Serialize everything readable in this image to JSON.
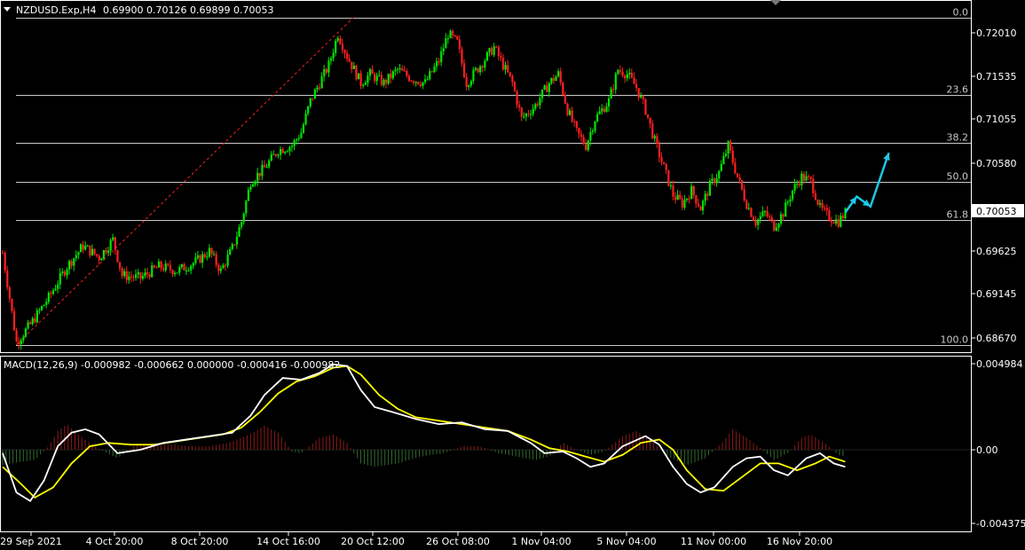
{
  "header": {
    "symbol_timeframe": "NZDUSD.Exp,H4",
    "ohlc": "0.69900 0.70126 0.69899 0.70053"
  },
  "macd": {
    "label": "MACD(12,26,9) -0.000982 -0.000662 0.000000 -0.000416 -0.000982"
  },
  "current_price": "0.70053",
  "colors": {
    "background": "#000000",
    "bull_candle": "#00e600",
    "bear_candle": "#ff2020",
    "fib_lines": "#c8c8c8",
    "fib_trend": "#ff2020",
    "macd_line": "#ffffff",
    "signal_line": "#ffff00",
    "hist_pos": "#8b1a1a",
    "hist_neg": "#2f6b2f",
    "arrows": "#1ec8e6",
    "axis": "#ffffff"
  },
  "chart_data": [
    {
      "type": "candlestick",
      "ylim": [
        0.6845,
        0.724
      ],
      "y_ticks": [
        "0.72010",
        "0.71535",
        "0.71055",
        "0.70580",
        "0.70100",
        "0.69625",
        "0.69145",
        "0.68670"
      ],
      "x_ticks": [
        "29 Sep 2021",
        "4 Oct 20:00",
        "8 Oct 20:00",
        "14 Oct 16:00",
        "20 Oct 12:00",
        "26 Oct 08:00",
        "1 Nov 04:00",
        "5 Nov 04:00",
        "11 Nov 00:00",
        "16 Nov 20:00"
      ],
      "fibonacci": [
        {
          "label": "0.0",
          "price": 0.7223
        },
        {
          "label": "23.6",
          "price": 0.7137
        },
        {
          "label": "38.2",
          "price": 0.7083
        },
        {
          "label": "50.0",
          "price": 0.704
        },
        {
          "label": "61.8",
          "price": 0.6997
        },
        {
          "label": "100.0",
          "price": 0.6857
        }
      ],
      "close_path": [
        [
          0,
          0.696
        ],
        [
          6,
          0.686
        ],
        [
          12,
          0.688
        ],
        [
          20,
          0.691
        ],
        [
          28,
          0.6945
        ],
        [
          35,
          0.6968
        ],
        [
          42,
          0.6955
        ],
        [
          48,
          0.6975
        ],
        [
          52,
          0.6935
        ],
        [
          60,
          0.6932
        ],
        [
          68,
          0.6945
        ],
        [
          76,
          0.694
        ],
        [
          84,
          0.695
        ],
        [
          90,
          0.6962
        ],
        [
          95,
          0.694
        ],
        [
          100,
          0.6965
        ],
        [
          104,
          0.6995
        ],
        [
          108,
          0.704
        ],
        [
          114,
          0.7055
        ],
        [
          120,
          0.7075
        ],
        [
          126,
          0.708
        ],
        [
          130,
          0.7095
        ],
        [
          134,
          0.713
        ],
        [
          138,
          0.715
        ],
        [
          142,
          0.717
        ],
        [
          146,
          0.7205
        ],
        [
          150,
          0.718
        ],
        [
          156,
          0.715
        ],
        [
          160,
          0.716
        ],
        [
          166,
          0.715
        ],
        [
          172,
          0.7165
        ],
        [
          178,
          0.7155
        ],
        [
          184,
          0.715
        ],
        [
          190,
          0.7175
        ],
        [
          194,
          0.7205
        ],
        [
          198,
          0.7195
        ],
        [
          202,
          0.715
        ],
        [
          208,
          0.717
        ],
        [
          214,
          0.719
        ],
        [
          218,
          0.717
        ],
        [
          222,
          0.715
        ],
        [
          226,
          0.711
        ],
        [
          232,
          0.7125
        ],
        [
          238,
          0.715
        ],
        [
          242,
          0.716
        ],
        [
          246,
          0.712
        ],
        [
          250,
          0.7095
        ],
        [
          254,
          0.708
        ],
        [
          258,
          0.711
        ],
        [
          264,
          0.713
        ],
        [
          268,
          0.7165
        ],
        [
          272,
          0.716
        ],
        [
          276,
          0.7145
        ],
        [
          280,
          0.712
        ],
        [
          284,
          0.7085
        ],
        [
          288,
          0.7055
        ],
        [
          292,
          0.7025
        ],
        [
          296,
          0.7015
        ],
        [
          300,
          0.703
        ],
        [
          304,
          0.701
        ],
        [
          308,
          0.7035
        ],
        [
          312,
          0.705
        ],
        [
          316,
          0.708
        ],
        [
          320,
          0.7045
        ],
        [
          324,
          0.7015
        ],
        [
          328,
          0.6995
        ],
        [
          332,
          0.7005
        ],
        [
          336,
          0.699
        ],
        [
          340,
          0.7005
        ],
        [
          344,
          0.703
        ],
        [
          348,
          0.7045
        ],
        [
          352,
          0.704
        ],
        [
          356,
          0.701
        ],
        [
          360,
          0.7
        ],
        [
          364,
          0.6995
        ],
        [
          367,
          0.7005
        ]
      ],
      "annotation_path": [
        [
          367,
          0.70053
        ],
        [
          372,
          0.7023
        ],
        [
          378,
          0.7012
        ],
        [
          386,
          0.7072
        ]
      ]
    },
    {
      "type": "macd",
      "params": "12,26,9",
      "y_ticks": [
        "0.004984",
        "0.00",
        "-0.004375"
      ],
      "ylim": [
        -0.00492,
        0.00534
      ],
      "macd_line": [
        [
          0,
          -0.0002
        ],
        [
          6,
          -0.0025
        ],
        [
          12,
          -0.003
        ],
        [
          18,
          -0.0018
        ],
        [
          24,
          0.0002
        ],
        [
          30,
          0.001
        ],
        [
          36,
          0.0012
        ],
        [
          42,
          0.0009
        ],
        [
          50,
          -0.0002
        ],
        [
          60,
          0.0
        ],
        [
          70,
          0.0004
        ],
        [
          80,
          0.0006
        ],
        [
          90,
          0.0008
        ],
        [
          100,
          0.001
        ],
        [
          108,
          0.002
        ],
        [
          114,
          0.0032
        ],
        [
          122,
          0.0042
        ],
        [
          130,
          0.0041
        ],
        [
          138,
          0.0045
        ],
        [
          144,
          0.005
        ],
        [
          150,
          0.0049
        ],
        [
          156,
          0.0035
        ],
        [
          162,
          0.0025
        ],
        [
          170,
          0.0022
        ],
        [
          180,
          0.0018
        ],
        [
          190,
          0.0015
        ],
        [
          200,
          0.0016
        ],
        [
          210,
          0.0012
        ],
        [
          220,
          0.0011
        ],
        [
          230,
          0.0004
        ],
        [
          236,
          -0.0002
        ],
        [
          244,
          -0.0001
        ],
        [
          250,
          -0.0005
        ],
        [
          256,
          -0.001
        ],
        [
          262,
          -0.0008
        ],
        [
          270,
          0.0002
        ],
        [
          280,
          0.0008
        ],
        [
          286,
          0.0003
        ],
        [
          292,
          -0.001
        ],
        [
          298,
          -0.002
        ],
        [
          304,
          -0.0025
        ],
        [
          310,
          -0.0022
        ],
        [
          318,
          -0.001
        ],
        [
          324,
          -0.0005
        ],
        [
          330,
          -0.0004
        ],
        [
          336,
          -0.0012
        ],
        [
          342,
          -0.0015
        ],
        [
          350,
          -0.0005
        ],
        [
          356,
          -0.0002
        ],
        [
          362,
          -0.0008
        ],
        [
          367,
          -0.001
        ]
      ],
      "signal_line": [
        [
          0,
          -0.001
        ],
        [
          8,
          -0.002
        ],
        [
          14,
          -0.0028
        ],
        [
          22,
          -0.0022
        ],
        [
          30,
          -0.0008
        ],
        [
          38,
          0.0002
        ],
        [
          46,
          0.0004
        ],
        [
          56,
          0.0003
        ],
        [
          66,
          0.0003
        ],
        [
          76,
          0.0005
        ],
        [
          86,
          0.0007
        ],
        [
          96,
          0.0009
        ],
        [
          104,
          0.0013
        ],
        [
          112,
          0.0022
        ],
        [
          120,
          0.0033
        ],
        [
          128,
          0.004
        ],
        [
          136,
          0.0043
        ],
        [
          144,
          0.0048
        ],
        [
          150,
          0.0049
        ],
        [
          156,
          0.0044
        ],
        [
          164,
          0.0032
        ],
        [
          172,
          0.0024
        ],
        [
          180,
          0.0019
        ],
        [
          190,
          0.0017
        ],
        [
          200,
          0.0015
        ],
        [
          210,
          0.0013
        ],
        [
          220,
          0.0011
        ],
        [
          230,
          0.0006
        ],
        [
          238,
          0.0001
        ],
        [
          246,
          -0.0001
        ],
        [
          254,
          -0.0004
        ],
        [
          262,
          -0.0007
        ],
        [
          270,
          -0.0003
        ],
        [
          278,
          0.0004
        ],
        [
          286,
          0.0006
        ],
        [
          292,
          0.0
        ],
        [
          298,
          -0.0012
        ],
        [
          306,
          -0.0023
        ],
        [
          314,
          -0.0024
        ],
        [
          322,
          -0.0016
        ],
        [
          330,
          -0.0008
        ],
        [
          338,
          -0.0008
        ],
        [
          346,
          -0.0012
        ],
        [
          354,
          -0.0008
        ],
        [
          360,
          -0.0004
        ],
        [
          367,
          -0.0007
        ]
      ],
      "histogram": [
        [
          0,
          -0.0009
        ],
        [
          8,
          -0.0007
        ],
        [
          14,
          -0.0006
        ],
        [
          20,
          0.0002
        ],
        [
          24,
          0.0011
        ],
        [
          28,
          0.0015
        ],
        [
          32,
          0.001
        ],
        [
          38,
          0.0004
        ],
        [
          44,
          -0.0001
        ],
        [
          50,
          -0.0005
        ],
        [
          58,
          0.0003
        ],
        [
          66,
          0.0003
        ],
        [
          74,
          0.0003
        ],
        [
          82,
          0.0002
        ],
        [
          90,
          0.0002
        ],
        [
          98,
          0.0004
        ],
        [
          106,
          0.0008
        ],
        [
          114,
          0.0014
        ],
        [
          120,
          0.001
        ],
        [
          126,
          -0.0001
        ],
        [
          130,
          -0.0002
        ],
        [
          138,
          0.0007
        ],
        [
          144,
          0.0009
        ],
        [
          150,
          0.0004
        ],
        [
          156,
          -0.0008
        ],
        [
          162,
          -0.001
        ],
        [
          172,
          -0.0008
        ],
        [
          182,
          -0.0004
        ],
        [
          192,
          -0.0002
        ],
        [
          200,
          0.0002
        ],
        [
          208,
          0.0002
        ],
        [
          216,
          -0.0002
        ],
        [
          224,
          -0.0004
        ],
        [
          232,
          -0.0006
        ],
        [
          238,
          -0.0004
        ],
        [
          244,
          0.0004
        ],
        [
          250,
          0.0
        ],
        [
          256,
          -0.0003
        ],
        [
          262,
          -0.0001
        ],
        [
          270,
          0.0008
        ],
        [
          276,
          0.0011
        ],
        [
          282,
          0.0006
        ],
        [
          290,
          -0.0004
        ],
        [
          298,
          -0.0009
        ],
        [
          306,
          -0.0005
        ],
        [
          314,
          0.0005
        ],
        [
          318,
          0.0012
        ],
        [
          324,
          0.0007
        ],
        [
          330,
          0.0001
        ],
        [
          336,
          -0.0006
        ],
        [
          342,
          -0.0002
        ],
        [
          348,
          0.0007
        ],
        [
          352,
          0.0009
        ],
        [
          358,
          0.0004
        ],
        [
          364,
          -0.0003
        ],
        [
          367,
          -0.0004
        ]
      ]
    }
  ]
}
